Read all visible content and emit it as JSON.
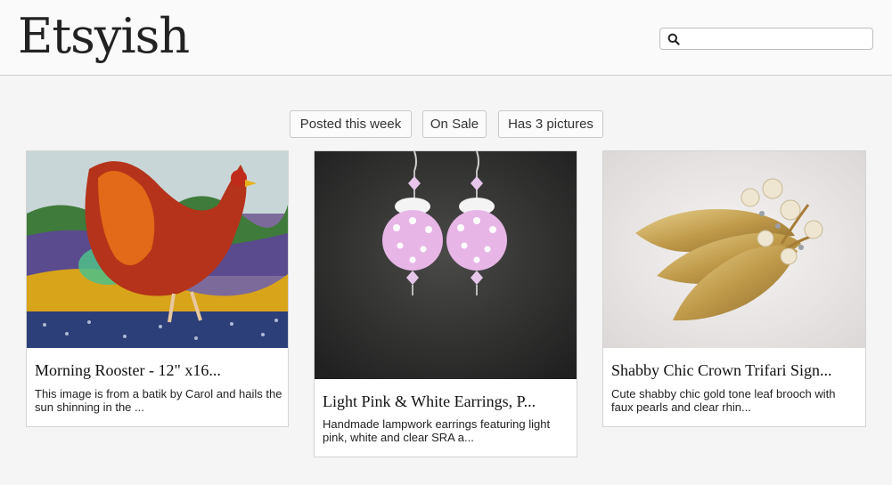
{
  "app": {
    "logo": "Etsyish"
  },
  "search": {
    "placeholder": ""
  },
  "filters": [
    {
      "label": "Posted this week"
    },
    {
      "label": "On Sale"
    },
    {
      "label": "Has 3 pictures"
    }
  ],
  "listings": [
    {
      "title": "Morning Rooster - 12\" x16...",
      "description": "This image is from a batik by Carol and hails the sun shinning in the ...",
      "image": "rooster-batik-image"
    },
    {
      "title": "Light Pink & White Earrings, P...",
      "description": "Handmade lampwork earrings featuring light pink, white and clear SRA a...",
      "image": "pink-earrings-image"
    },
    {
      "title": "Shabby Chic Crown Trifari Sign...",
      "description": "Cute shabby chic gold tone leaf brooch with faux pearls and clear rhin...",
      "image": "gold-leaf-brooch-image"
    }
  ]
}
